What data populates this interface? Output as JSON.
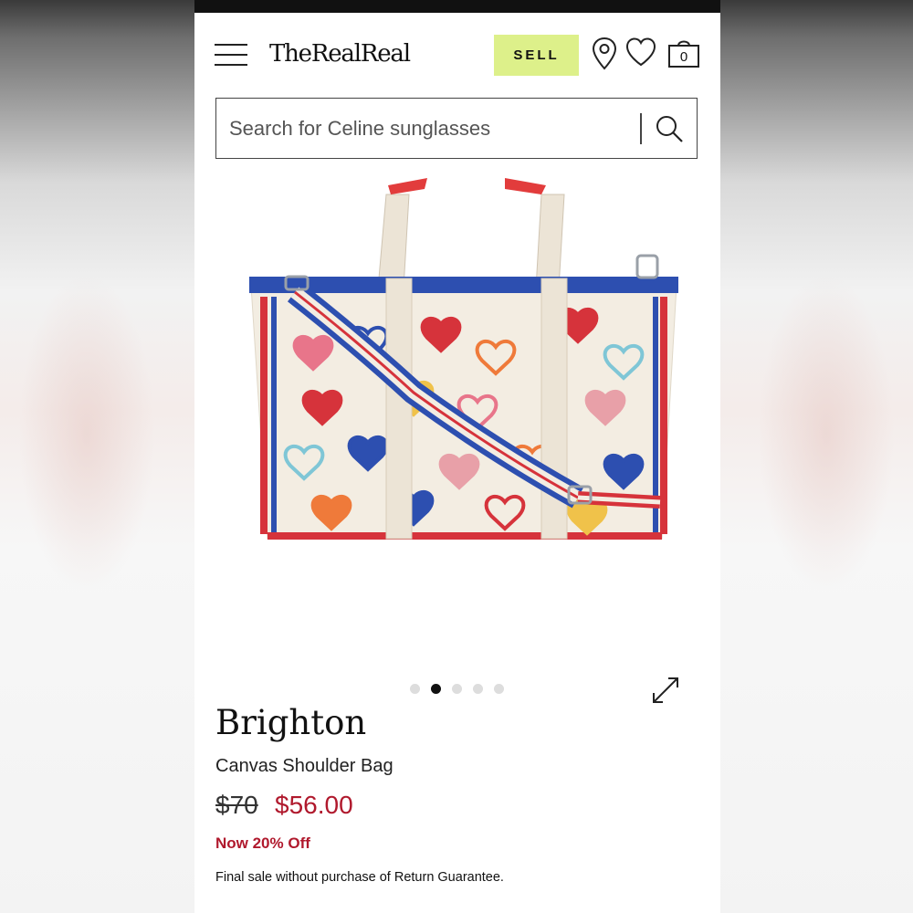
{
  "header": {
    "logo": "TheRealReal",
    "sell_label": "SELL",
    "cart_count": "0",
    "icons": [
      "menu-icon",
      "location-pin-icon",
      "heart-icon",
      "shopping-bag-icon"
    ]
  },
  "search": {
    "placeholder": "Search for Celine sunglasses",
    "icon": "search-icon"
  },
  "gallery": {
    "image": "canvas-heart-print-tote-image",
    "total_images": 5,
    "active_index": 1,
    "expand_icon": "expand-icon"
  },
  "product": {
    "brand": "Brighton",
    "name": "Canvas Shoulder Bag",
    "original_price": "$70",
    "sale_price": "$56.00",
    "discount": "Now 20% Off",
    "note": "Final sale without purchase of Return Guarantee."
  },
  "colors": {
    "sell_bg": "#ddf08a",
    "sale_red": "#b0192d",
    "text": "#111111"
  }
}
